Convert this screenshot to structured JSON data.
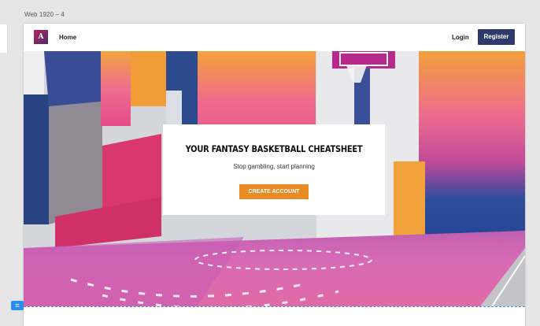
{
  "artboard": {
    "label": "Web 1920 – 4"
  },
  "nav": {
    "logo_letter": "A",
    "home_label": "Home",
    "login_label": "Login",
    "register_label": "Register"
  },
  "hero": {
    "title": "YOUR FANTASY BASKETBALL CHEATSHEET",
    "subtitle": "Stop gambling, start planning",
    "cta_label": "CREATE ACCOUNT",
    "image_icon": "basketball-court-photo"
  },
  "colors": {
    "register_bg": "#2e3a6b",
    "cta_bg": "#e98b24",
    "logo_gradient": [
      "#b5245f",
      "#4a2c6e"
    ]
  },
  "comment_badge": {
    "icon": "equals-icon"
  }
}
